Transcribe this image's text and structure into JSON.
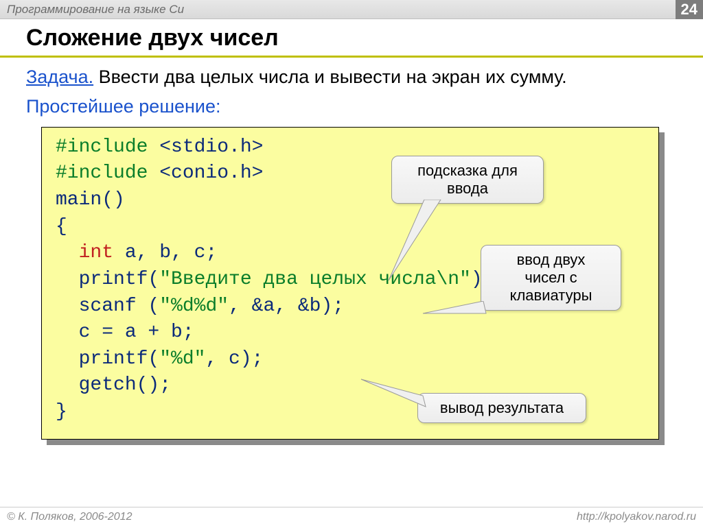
{
  "header": {
    "title": "Программирование на языке Си",
    "page": "24"
  },
  "slide": {
    "heading": "Сложение двух чисел",
    "task_label": "Задача.",
    "task_text": " Ввести два целых числа и вывести на экран их сумму.",
    "simplest": "Простейшее решение:"
  },
  "code": {
    "include1_kw": "#include",
    "include1_hdr": " <stdio.h>",
    "include2_kw": "#include",
    "include2_hdr": " <conio.h>",
    "main": "main()",
    "open": "{",
    "int_kw": "int",
    "int_rest": " a, b, c;",
    "printf1_fn": "printf(",
    "printf1_str": "\"Введите два целых числа\\n\"",
    "printf1_end": ");",
    "scanf_fn": "scanf (",
    "scanf_str": "\"%d%d\"",
    "scanf_end": ", &a, &b);",
    "assign": "  c = a + b;",
    "printf2_fn": "printf(",
    "printf2_str": "\"%d\"",
    "printf2_end": ", c);",
    "getch": "  getch();",
    "close": "}"
  },
  "callouts": {
    "hint_line1": "подсказка для",
    "hint_line2": "ввода",
    "input_line1": "ввод двух",
    "input_line2": "чисел с",
    "input_line3": "клавиатуры",
    "output": "вывод результата"
  },
  "footer": {
    "copyright": "© К. Поляков, 2006-2012",
    "url": "http://kpolyakov.narod.ru"
  }
}
